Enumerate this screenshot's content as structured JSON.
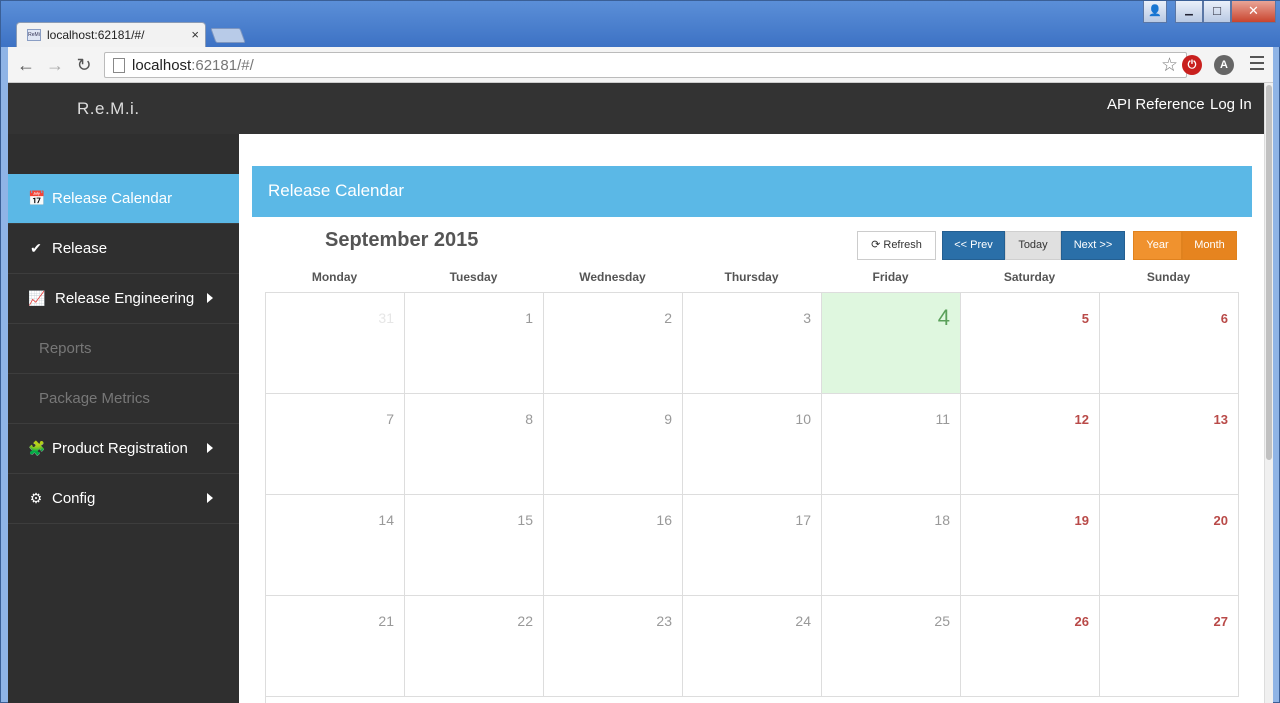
{
  "browser": {
    "tab_title": "localhost:62181/#/",
    "tab_close": "×",
    "favicon_text": "ReMi",
    "url_host": "localhost",
    "url_rest": ":62181/#/",
    "back": "←",
    "forward": "→",
    "reload": "↻",
    "star": "☆",
    "ext_red": "⏻",
    "ext_angular": "A",
    "win_user": "👤",
    "win_min": "▁",
    "win_max": "□",
    "win_close": "✕"
  },
  "app": {
    "brand": "R.e.M.i.",
    "nav": {
      "api_reference": "API Reference",
      "login": "Log In"
    }
  },
  "sidebar": {
    "items": [
      {
        "label": "Release Calendar",
        "icon": "📅",
        "active": true
      },
      {
        "label": "Release",
        "icon": "✔"
      },
      {
        "label": "Release Engineering",
        "icon": "📈"
      },
      {
        "label": "Reports"
      },
      {
        "label": "Package Metrics"
      },
      {
        "label": "Product Registration",
        "icon": "🧩"
      },
      {
        "label": "Config",
        "icon": "⚙"
      }
    ]
  },
  "calendar": {
    "panel_title": "Release Calendar",
    "month_title": "September 2015",
    "buttons": {
      "refresh": "Refresh",
      "prev": "<< Prev",
      "today": "Today",
      "next": "Next >>",
      "year": "Year",
      "month": "Month"
    },
    "days": [
      "Monday",
      "Tuesday",
      "Wednesday",
      "Thursday",
      "Friday",
      "Saturday",
      "Sunday"
    ],
    "weeks": [
      [
        "31",
        "1",
        "2",
        "3",
        "4",
        "5",
        "6"
      ],
      [
        "7",
        "8",
        "9",
        "10",
        "11",
        "12",
        "13"
      ],
      [
        "14",
        "15",
        "16",
        "17",
        "18",
        "19",
        "20"
      ],
      [
        "21",
        "22",
        "23",
        "24",
        "25",
        "26",
        "27"
      ]
    ],
    "today": "4"
  }
}
